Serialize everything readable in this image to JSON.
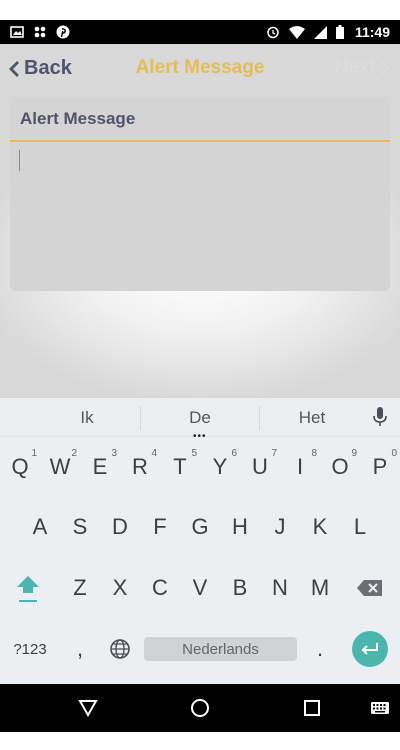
{
  "status_bar": {
    "time": "11:49",
    "left_icons": [
      "image-icon",
      "photo-sync-icon",
      "pinterest-icon"
    ],
    "right_icons": [
      "alarm-icon",
      "wifi-icon",
      "signal-icon",
      "battery-icon"
    ]
  },
  "nav": {
    "back_label": "Back",
    "title": "Alert Message",
    "next_label": "Next",
    "accent_color": "#e4bd55",
    "text_color": "#4f5468"
  },
  "form": {
    "field_label": "Alert Message",
    "field_value": ""
  },
  "suggestions": {
    "items": [
      "Ik",
      "De",
      "Het"
    ],
    "mic_icon": "microphone-icon"
  },
  "keyboard": {
    "row1": [
      {
        "key": "Q",
        "hint": "1"
      },
      {
        "key": "W",
        "hint": "2"
      },
      {
        "key": "E",
        "hint": "3"
      },
      {
        "key": "R",
        "hint": "4"
      },
      {
        "key": "T",
        "hint": "5"
      },
      {
        "key": "Y",
        "hint": "6"
      },
      {
        "key": "U",
        "hint": "7"
      },
      {
        "key": "I",
        "hint": "8"
      },
      {
        "key": "O",
        "hint": "9"
      },
      {
        "key": "P",
        "hint": "0"
      }
    ],
    "row2": [
      "A",
      "S",
      "D",
      "F",
      "G",
      "H",
      "J",
      "K",
      "L"
    ],
    "row3": [
      "Z",
      "X",
      "C",
      "V",
      "B",
      "N",
      "M"
    ],
    "symbols_label": "?123",
    "comma_label": ",",
    "space_label": "Nederlands",
    "period_label": ".",
    "shift_icon": "shift-icon",
    "backspace_icon": "backspace-icon",
    "language_icon": "globe-icon",
    "enter_icon": "enter-icon",
    "accent_color": "#4db6ac"
  },
  "system_nav": {
    "icons": [
      "back-triangle-icon",
      "home-circle-icon",
      "recents-square-icon",
      "keyboard-icon"
    ]
  }
}
